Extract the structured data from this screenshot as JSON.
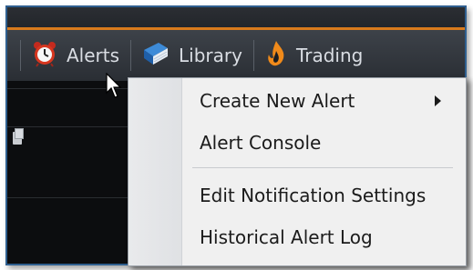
{
  "toolbar": {
    "items": [
      {
        "label": "Alerts",
        "icon": "alarm-clock-icon"
      },
      {
        "label": "Library",
        "icon": "book-icon"
      },
      {
        "label": "Trading",
        "icon": "flame-icon"
      }
    ]
  },
  "menu": {
    "items": [
      {
        "label": "Create New Alert",
        "has_submenu": true
      },
      {
        "label": "Alert Console"
      },
      {
        "label": "Edit Notification Settings"
      },
      {
        "label": "Historical Alert Log"
      }
    ]
  },
  "colors": {
    "accent": "#d87a1c",
    "frame_border": "#2f5f8f",
    "menu_bg": "#f0f0f0"
  }
}
